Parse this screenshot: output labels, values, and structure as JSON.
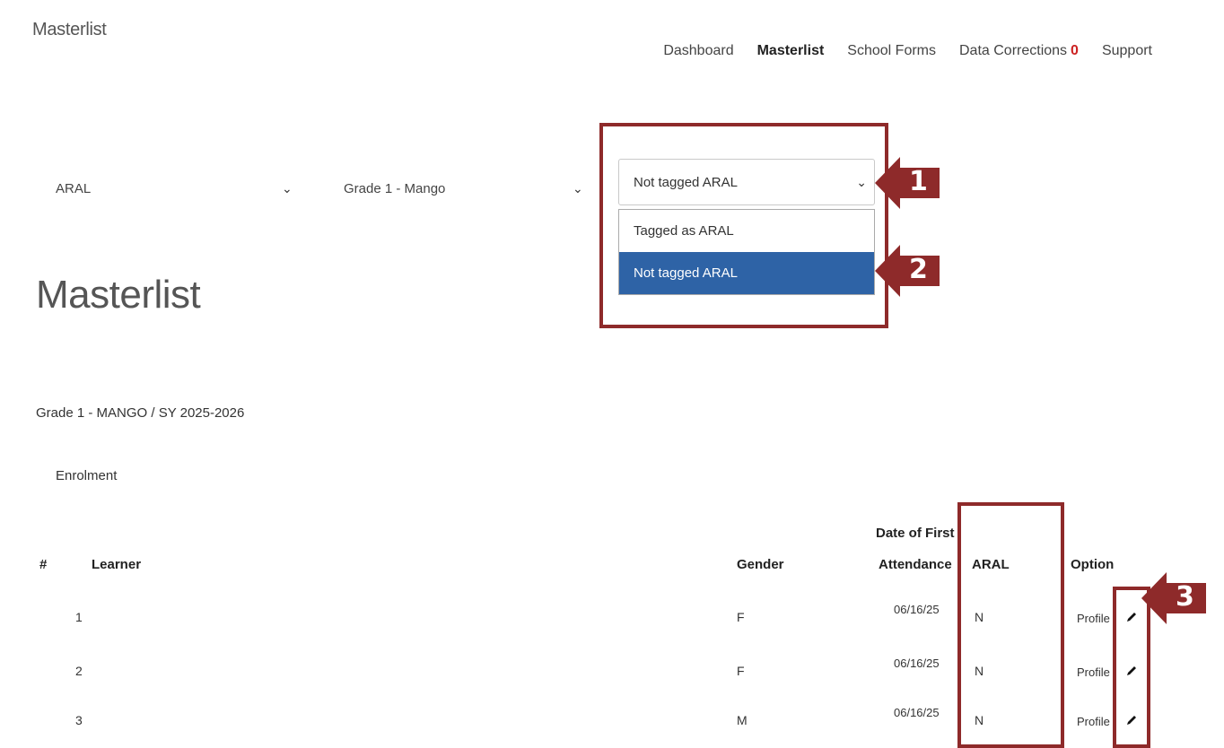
{
  "header": {
    "brand": "Masterlist",
    "nav": [
      {
        "label": "Dashboard"
      },
      {
        "label": "Masterlist",
        "active": true
      },
      {
        "label": "School Forms"
      },
      {
        "label": "Data Corrections",
        "badge": "0"
      },
      {
        "label": "Support"
      }
    ]
  },
  "filters": {
    "program": {
      "value": "ARAL"
    },
    "section": {
      "value": "Grade 1 - Mango"
    },
    "aral_tag": {
      "value": "Not tagged ARAL",
      "options": [
        {
          "label": "Tagged as ARAL",
          "selected": false
        },
        {
          "label": "Not tagged ARAL",
          "selected": true
        }
      ]
    }
  },
  "page": {
    "title": "Masterlist",
    "subtitle": "Grade 1 - MANGO / SY 2025-2026",
    "section_label": "Enrolment"
  },
  "table": {
    "headers": {
      "num": "#",
      "learner": "Learner",
      "gender": "Gender",
      "date_line1": "Date of First",
      "date_line2": "Attendance",
      "aral": "ARAL",
      "option": "Option"
    },
    "rows": [
      {
        "num": "1",
        "learner": "",
        "gender": "F",
        "date": "06/16/25",
        "aral": "N",
        "profile": "Profile"
      },
      {
        "num": "2",
        "learner": "",
        "gender": "F",
        "date": "06/16/25",
        "aral": "N",
        "profile": "Profile"
      },
      {
        "num": "3",
        "learner": "",
        "gender": "M",
        "date": "06/16/25",
        "aral": "N",
        "profile": "Profile"
      }
    ]
  },
  "annotations": {
    "callout_1": "1",
    "callout_2": "2",
    "callout_3": "3",
    "highlight_color": "#8e2a2a",
    "callout_color": "#8e2a2a"
  },
  "icons": {
    "chevron": "chevron-down-icon",
    "edit": "pencil-icon"
  },
  "colors": {
    "selected_option_bg": "#2e63a6",
    "badge": "#cc2222"
  }
}
